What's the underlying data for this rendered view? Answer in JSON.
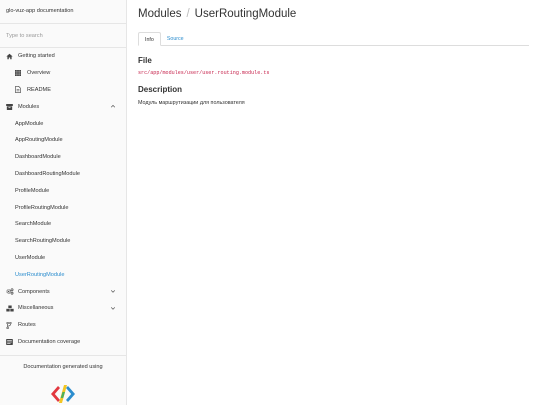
{
  "sidebar": {
    "title": "glo-vuz-app documentation",
    "search_placeholder": "Type to search",
    "items": [
      {
        "label": "Getting started",
        "icon": "home-icon"
      },
      {
        "label": "Overview",
        "icon": "grid-icon"
      },
      {
        "label": "README",
        "icon": "file-icon"
      },
      {
        "label": "Modules",
        "icon": "archive-icon"
      },
      {
        "label": "AppModule"
      },
      {
        "label": "AppRoutingModule"
      },
      {
        "label": "DashboardModule"
      },
      {
        "label": "DashboardRoutingModule"
      },
      {
        "label": "ProfileModule"
      },
      {
        "label": "ProfileRoutingModule"
      },
      {
        "label": "SearchModule"
      },
      {
        "label": "SearchRoutingModule"
      },
      {
        "label": "UserModule"
      },
      {
        "label": "UserRoutingModule"
      },
      {
        "label": "Components",
        "icon": "cogs-icon"
      },
      {
        "label": "Miscellaneous",
        "icon": "cubes-icon"
      },
      {
        "label": "Routes",
        "icon": "code-fork-icon"
      },
      {
        "label": "Documentation coverage",
        "icon": "tasks-icon"
      }
    ],
    "footer_text": "Documentation generated using",
    "accent_color": "#2b8dce"
  },
  "main": {
    "breadcrumb": [
      "Modules",
      "UserRoutingModule"
    ],
    "breadcrumb_separator": "/",
    "tabs": [
      {
        "label": "Info",
        "active": true
      },
      {
        "label": "Source",
        "active": false
      }
    ],
    "file_heading": "File",
    "file_path": "src/app/modules/user/user.routing.module.ts",
    "description_heading": "Description",
    "description_text": "Модуль маршрутизации для пользователя"
  }
}
